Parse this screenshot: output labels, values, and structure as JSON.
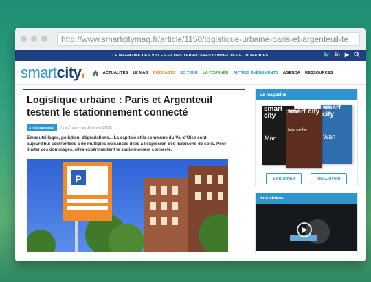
{
  "browser": {
    "url": "http://www.smartcitymag.fr/article/1150/logistique-urbaine-paris-et-argenteuil-te"
  },
  "site": {
    "tagline": "LE MAGAZINE DES VILLES ET DES TERRITOIRES CONNECTÉS ET DURABLES",
    "social": {
      "twitter": "🐦",
      "linkedin": "in",
      "youtube": "▶"
    },
    "logo": {
      "smart": "smart",
      "city": "city"
    },
    "nav": [
      {
        "label": "ACTUALITÉS",
        "color": "#1c1c1c"
      },
      {
        "label": "LE MAG",
        "color": "#1c1c1c"
      },
      {
        "label": "PODCASTS",
        "color": "#f07a2b"
      },
      {
        "label": "SC TOUR",
        "color": "#2f95cf"
      },
      {
        "label": "LA TOURNÉE",
        "color": "#3aa64a"
      },
      {
        "label": "AUTRES ÉVÉNEMENTS",
        "color": "#2f95cf"
      },
      {
        "label": "AGENDA",
        "color": "#1c1c1c"
      },
      {
        "label": "RESSOURCES",
        "color": "#1c1c1c"
      }
    ]
  },
  "article": {
    "title_line1": "Logistique urbaine : Paris et Argenteuil",
    "title_line2": "testent le stationnement connecté",
    "badge": "STATIONNEMENT",
    "meta": "Il y a 2 mois - par Jérômine DOUX",
    "lede": "Embouteillages, pollution, dégradations... La capitale et la commune du Val-d'Oise sont aujourd'hui confrontées à de multiples nuisances liées à l'explosion des livraisons de colis. Pour limiter ces dommages, elles expérimentent le stationnement connecté.",
    "sign_letter": "P"
  },
  "sidebar": {
    "magazine_title": "Le magazine",
    "covers": [
      {
        "title": "smart city",
        "subtitle": "Mon"
      },
      {
        "title": "smart city",
        "subtitle": "Marseille"
      },
      {
        "title": "smart city",
        "subtitle": "Wan"
      }
    ],
    "subscribe": "S'ABONNER",
    "discover": "DÉCOUVRIR",
    "videos_title": "Nos vidéos"
  },
  "colors": {
    "navy": "#1f3f80",
    "accent": "#2f95cf",
    "orange": "#f07a2b"
  }
}
